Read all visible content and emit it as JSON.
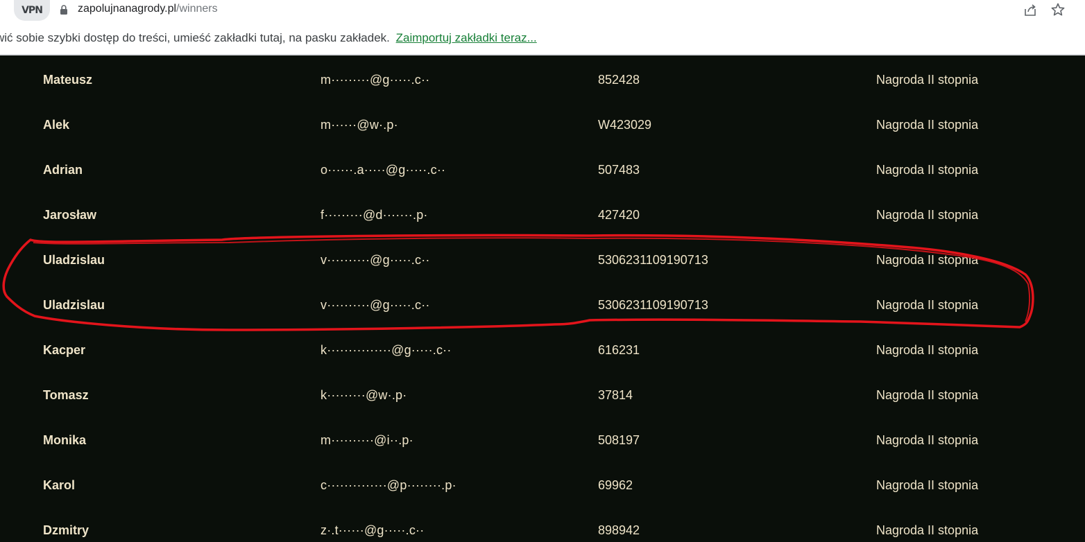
{
  "browser": {
    "vpn_label": "VPN",
    "url_host": "zapolujnanagrody.pl",
    "url_path": "/winners"
  },
  "bookmarks": {
    "hint": "wić sobie szybki dostęp do treści, umieść zakładki tutaj, na pasku zakładek.",
    "import_link": "Zaimportuj zakładki teraz..."
  },
  "winners": [
    {
      "name": "Mateusz",
      "email": "m·········@g·····.c··",
      "code": "852428",
      "prize": "Nagroda II stopnia"
    },
    {
      "name": "Alek",
      "email": "m······@w·.p·",
      "code": "W423029",
      "prize": "Nagroda II stopnia"
    },
    {
      "name": "Adrian",
      "email": "o······.a·····@g·····.c··",
      "code": "507483",
      "prize": "Nagroda II stopnia"
    },
    {
      "name": "Jarosław",
      "email": "f·········@d·······.p·",
      "code": "427420",
      "prize": "Nagroda II stopnia"
    },
    {
      "name": "Uladzislau",
      "email": "v··········@g·····.c··",
      "code": "5306231109190713",
      "prize": "Nagroda II stopnia"
    },
    {
      "name": "Uladzislau",
      "email": "v··········@g·····.c··",
      "code": "5306231109190713",
      "prize": "Nagroda II stopnia"
    },
    {
      "name": "Kacper",
      "email": "k···············@g·····.c··",
      "code": "616231",
      "prize": "Nagroda II stopnia"
    },
    {
      "name": "Tomasz",
      "email": "k·········@w·.p·",
      "code": "37814",
      "prize": "Nagroda II stopnia"
    },
    {
      "name": "Monika",
      "email": "m··········@i··.p·",
      "code": "508197",
      "prize": "Nagroda II stopnia"
    },
    {
      "name": "Karol",
      "email": "c··············@p········.p·",
      "code": "69962",
      "prize": "Nagroda II stopnia"
    },
    {
      "name": "Dzmitry",
      "email": "z·.t······@g·····.c··",
      "code": "898942",
      "prize": "Nagroda II stopnia"
    }
  ],
  "colors": {
    "page_background": "#0a0f0a",
    "table_text": "#efe4c8",
    "annotation_red": "#e3141b",
    "link_green": "#188038"
  }
}
